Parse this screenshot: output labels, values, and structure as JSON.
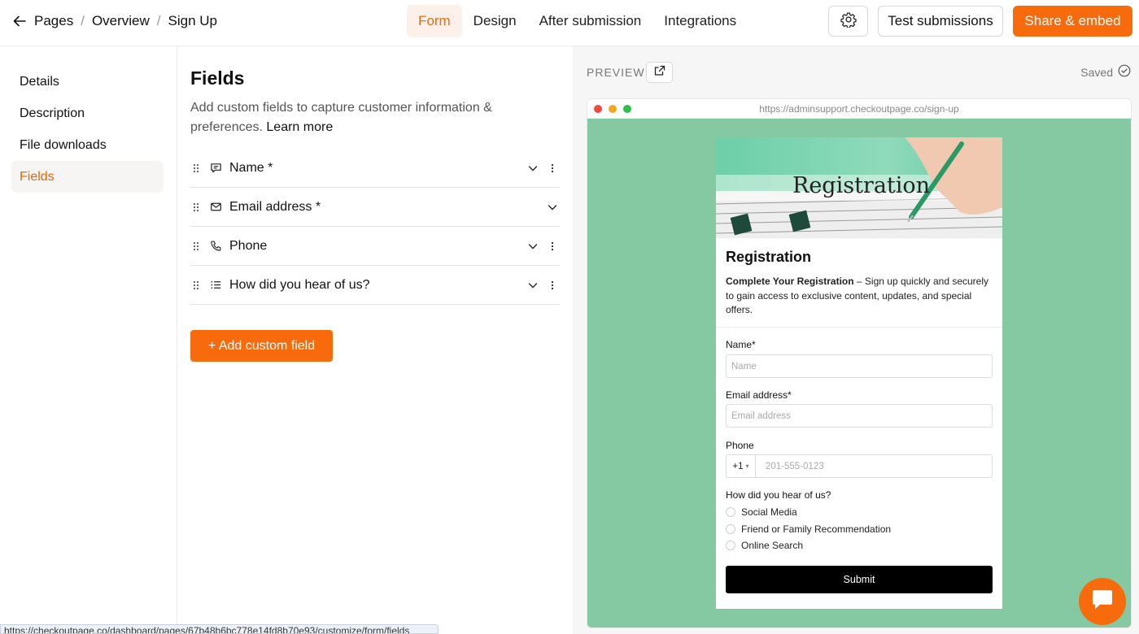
{
  "breadcrumb": {
    "items": [
      "Pages",
      "Overview",
      "Sign Up"
    ],
    "separator": "/"
  },
  "tabs": [
    {
      "label": "Form",
      "active": true
    },
    {
      "label": "Design",
      "active": false
    },
    {
      "label": "After submission",
      "active": false
    },
    {
      "label": "Integrations",
      "active": false
    }
  ],
  "toolbar": {
    "test_label": "Test submissions",
    "share_label": "Share & embed",
    "accent_color": "#f76b0c"
  },
  "sidebar": {
    "items": [
      {
        "label": "Details",
        "active": false
      },
      {
        "label": "Description",
        "active": false
      },
      {
        "label": "File downloads",
        "active": false
      },
      {
        "label": "Fields",
        "active": true
      }
    ]
  },
  "fields_panel": {
    "title": "Fields",
    "description": "Add custom fields to capture customer information & preferences.",
    "learn_more": "Learn more",
    "fields": [
      {
        "label": "Name *",
        "icon": "text-field-icon",
        "has_menu": true
      },
      {
        "label": "Email address *",
        "icon": "mail-icon",
        "has_menu": false
      },
      {
        "label": "Phone",
        "icon": "phone-icon",
        "has_menu": true
      },
      {
        "label": "How did you hear of us?",
        "icon": "list-icon",
        "has_menu": true
      }
    ],
    "add_label": "+ Add custom field"
  },
  "preview": {
    "label": "PREVIEW",
    "status": "Saved",
    "url": "https://adminsupport.checkoutpage.co/sign-up",
    "background_color": "#84c9a1",
    "hero_text": "Registration",
    "form": {
      "title": "Registration",
      "intro_bold": "Complete Your Registration",
      "intro_rest": " – Sign up quickly and securely to gain access to exclusive content, updates, and special offers.",
      "name_label": "Name",
      "name_placeholder": "Name",
      "email_label": "Email address",
      "email_placeholder": "Email address",
      "required_mark": "*",
      "phone_label": "Phone",
      "phone_code": "+1",
      "phone_placeholder": "201-555-0123",
      "source_label": "How did you hear of us?",
      "source_options": [
        "Social Media",
        "Friend or Family Recommendation",
        "Online Search"
      ],
      "submit_label": "Submit"
    }
  },
  "status_bar": {
    "url": "https://checkoutpage.co/dashboard/pages/67b48b6bc778e14fd8b70e93/customize/form/fields"
  }
}
